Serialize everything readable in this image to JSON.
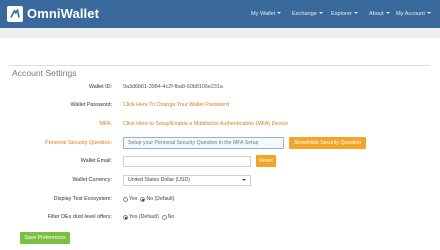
{
  "brand": {
    "name": "OmniWallet",
    "logo_icon": "omni-logo-icon"
  },
  "nav": {
    "items": [
      {
        "label": "My Wallet"
      },
      {
        "label": "Exchange"
      },
      {
        "label": "Explorer"
      },
      {
        "label": "About"
      },
      {
        "label": "My Account"
      }
    ]
  },
  "page": {
    "title": "Account Settings"
  },
  "settings": {
    "wallet_id_label": "Wallet ID:",
    "wallet_id_value": "9a3d6b61-3984-4c2f-fba8-60b8106e231a",
    "password_label": "Wallet Password:",
    "password_link": "Click Here To Change Your Wallet Password",
    "mfa_label": "MFA:",
    "mfa_link": "Click Here to Setup/Enable a Multifactor Authentication (MFA) Device",
    "security_question_label": "Personal Security Question:",
    "security_question_placeholder": "Setup your Personal Security Question in the MFA Setup",
    "show_hide_button": "Show/Hide Security Question",
    "email_label": "Wallet Email:",
    "email_value": "",
    "reset_button": "Reset",
    "currency_label": "Wallet Currency:",
    "currency_value": "United States Dollar (USD)",
    "test_ecosystem_label": "Display Test Ecosystem:",
    "test_ecosystem_yes": "Yes",
    "test_ecosystem_no": "No (Default)",
    "test_ecosystem_selected": "No (Default)",
    "dust_label": "Filter DEx dust level offers:",
    "dust_yes": "Yes (Default)",
    "dust_no": "No",
    "dust_selected": "Yes (Default)",
    "save_button": "Save Preferences"
  },
  "colors": {
    "navbar": "#3a6a9b",
    "accent_orange": "#e2791b",
    "button_orange": "#f3a52a",
    "button_green": "#7ac143"
  }
}
